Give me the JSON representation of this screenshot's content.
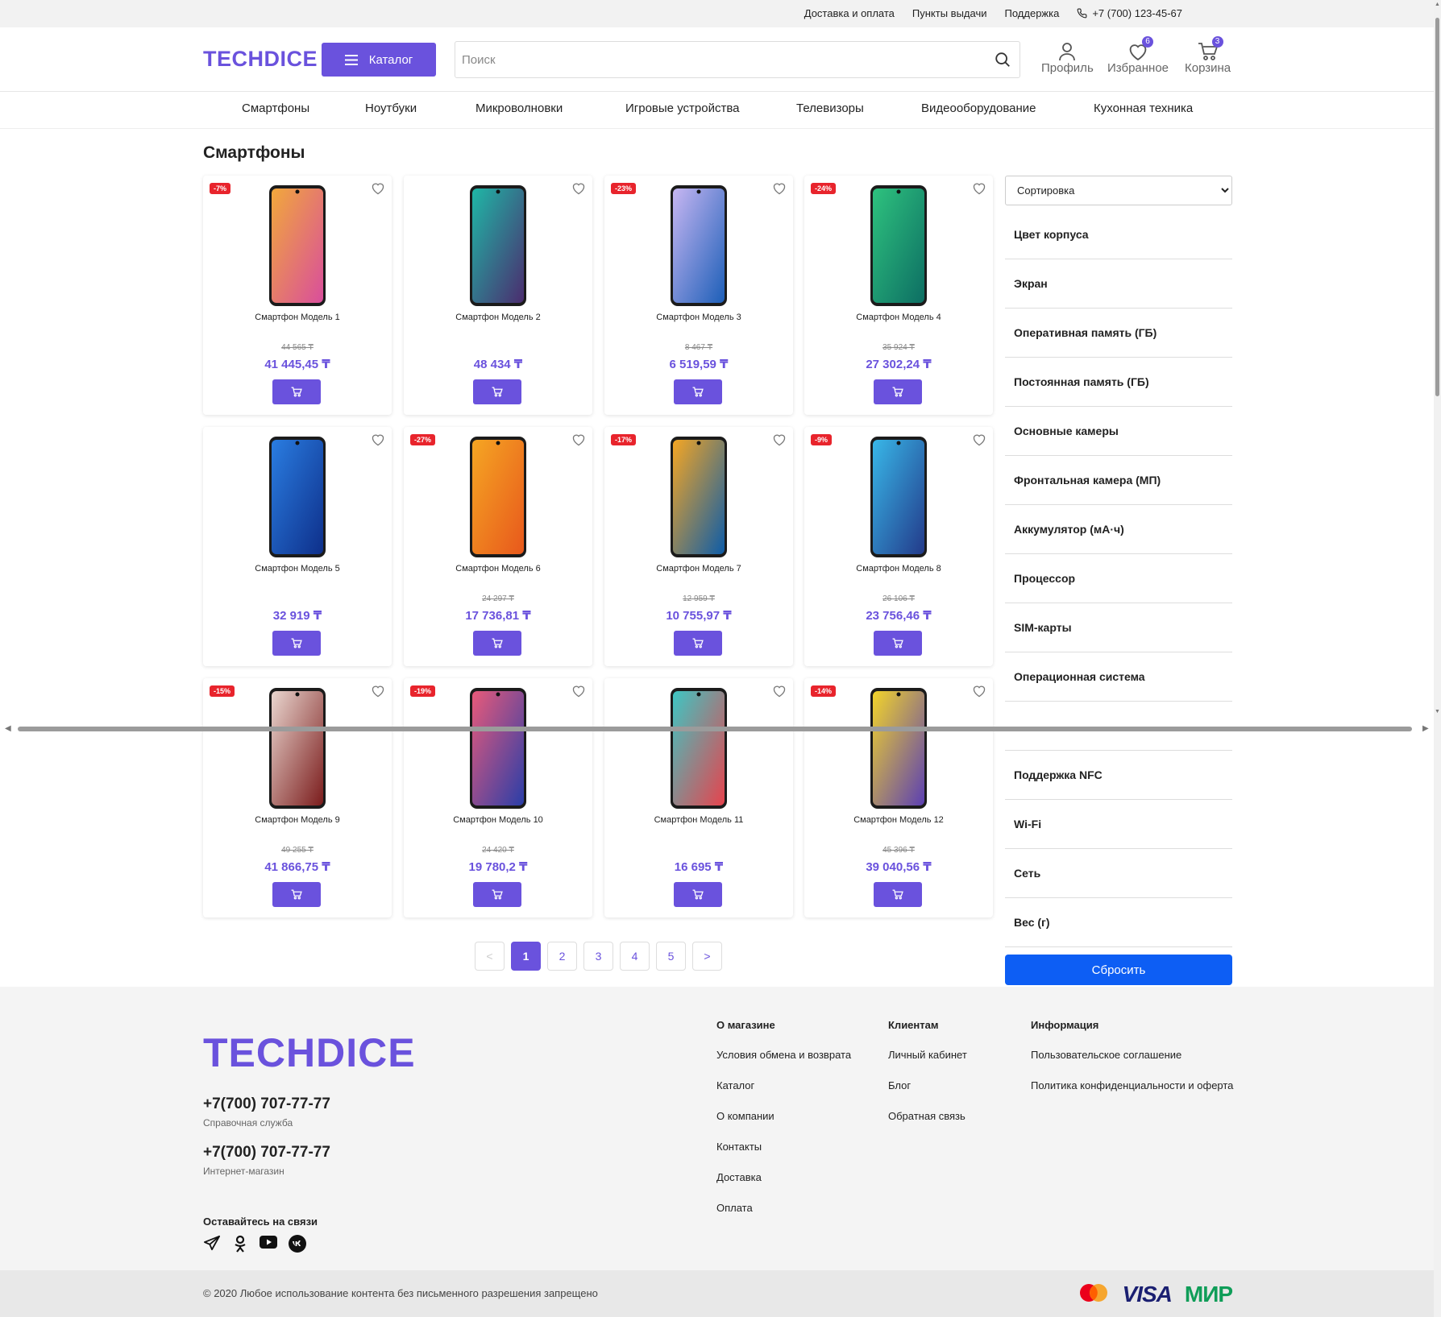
{
  "topbar": {
    "links": [
      "Доставка и оплата",
      "Пункты выдачи",
      "Поддержка"
    ],
    "phone": "+7 (700) 123-45-67"
  },
  "header": {
    "logo": "TECHDICE",
    "catalog_label": "Каталог",
    "search_placeholder": "Поиск",
    "profile_label": "Профиль",
    "favorites_label": "Избранное",
    "favorites_count": "6",
    "cart_label": "Корзина",
    "cart_count": "3"
  },
  "nav": [
    "Смартфоны",
    "Ноутбуки",
    "Микроволновки",
    "Игровые устройства",
    "Телевизоры",
    "Видеооборудование",
    "Кухонная техника"
  ],
  "page_title": "Смартфоны",
  "products": [
    {
      "name": "Смартфон Модель 1",
      "discount": "-7%",
      "old_price": "44 565 ₸",
      "price": "41 445,45 ₸",
      "colors": [
        "#f1a83b",
        "#d94e9c"
      ]
    },
    {
      "name": "Смартфон Модель 2",
      "discount": "",
      "old_price": "",
      "price": "48 434 ₸",
      "colors": [
        "#1fb7a6",
        "#4b2c6f"
      ]
    },
    {
      "name": "Смартфон Модель 3",
      "discount": "-23%",
      "old_price": "8 467 ₸",
      "price": "6 519,59 ₸",
      "colors": [
        "#c7b6f2",
        "#1d5fb8"
      ]
    },
    {
      "name": "Смартфон Модель 4",
      "discount": "-24%",
      "old_price": "35 924 ₸",
      "price": "27 302,24 ₸",
      "colors": [
        "#2ec27e",
        "#0d6e63"
      ]
    },
    {
      "name": "Смартфон Модель 5",
      "discount": "",
      "old_price": "",
      "price": "32 919 ₸",
      "colors": [
        "#2a7de1",
        "#0e2f8a"
      ]
    },
    {
      "name": "Смартфон Модель 6",
      "discount": "-27%",
      "old_price": "24 297 ₸",
      "price": "17 736,81 ₸",
      "colors": [
        "#f5a623",
        "#e8581c"
      ]
    },
    {
      "name": "Смартфон Модель 7",
      "discount": "-17%",
      "old_price": "12 959 ₸",
      "price": "10 755,97 ₸",
      "colors": [
        "#f5a623",
        "#0d5ca8"
      ]
    },
    {
      "name": "Смартфон Модель 8",
      "discount": "-9%",
      "old_price": "26 106 ₸",
      "price": "23 756,46 ₸",
      "colors": [
        "#38b7e8",
        "#233a8a"
      ]
    },
    {
      "name": "Смартфон Модель 9",
      "discount": "-15%",
      "old_price": "49 255 ₸",
      "price": "41 866,75 ₸",
      "colors": [
        "#e9d6cf",
        "#7b1c1c"
      ]
    },
    {
      "name": "Смартфон Модель 10",
      "discount": "-19%",
      "old_price": "24 420 ₸",
      "price": "19 780,2 ₸",
      "colors": [
        "#e85a7a",
        "#2a3ea8"
      ]
    },
    {
      "name": "Смартфон Модель 11",
      "discount": "",
      "old_price": "",
      "price": "16 695 ₸",
      "colors": [
        "#3ec6c3",
        "#e6434d"
      ]
    },
    {
      "name": "Смартфон Модель 12",
      "discount": "-14%",
      "old_price": "45 396 ₸",
      "price": "39 040,56 ₸",
      "colors": [
        "#f2d42a",
        "#5b3fb3"
      ]
    }
  ],
  "sidebar": {
    "sort_label": "Сортировка",
    "filters": [
      "Цвет корпуса",
      "Экран",
      "Оперативная память (ГБ)",
      "Постоянная память (ГБ)",
      "Основные камеры",
      "Фронтальная камера (МП)",
      "Аккумулятор (мА·ч)",
      "Процессор",
      "SIM-карты",
      "Операционная система",
      "",
      "Поддержка NFC",
      "Wi-Fi",
      "Сеть",
      "Вес (г)"
    ],
    "reset_label": "Сбросить"
  },
  "pagination": {
    "prev": "<",
    "pages": [
      "1",
      "2",
      "3",
      "4",
      "5"
    ],
    "current": "1",
    "next": ">"
  },
  "footer": {
    "logo": "TECHDICE",
    "phones": [
      {
        "number": "+7(700) 707-77-77",
        "label": "Справочная служба"
      },
      {
        "number": "+7(700) 707-77-77",
        "label": "Интернет-магазин"
      }
    ],
    "stay_connected": "Оставайтесь на связи",
    "socials": [
      "telegram-icon",
      "odnoklassniki-icon",
      "youtube-icon",
      "vk-icon"
    ],
    "columns": [
      {
        "title": "О магазине",
        "links": [
          "Условия обмена и возврата",
          "Каталог",
          "О компании",
          "Контакты",
          "Доставка",
          "Оплата"
        ]
      },
      {
        "title": "Клиентам",
        "links": [
          "Личный кабинет",
          "Блог",
          "Обратная связь"
        ]
      },
      {
        "title": "Информация",
        "links": [
          "Пользовательское соглашение",
          "Политика конфиденциальности и оферта"
        ]
      }
    ],
    "copyright": "© 2020 Любое использование контента без письменного разрешения запрещено",
    "payments": {
      "visa": "VISA",
      "mir": "МИР"
    }
  },
  "colors": {
    "accent": "#6a52dd",
    "reset": "#0d5ef4",
    "discount": "#e8242c"
  }
}
